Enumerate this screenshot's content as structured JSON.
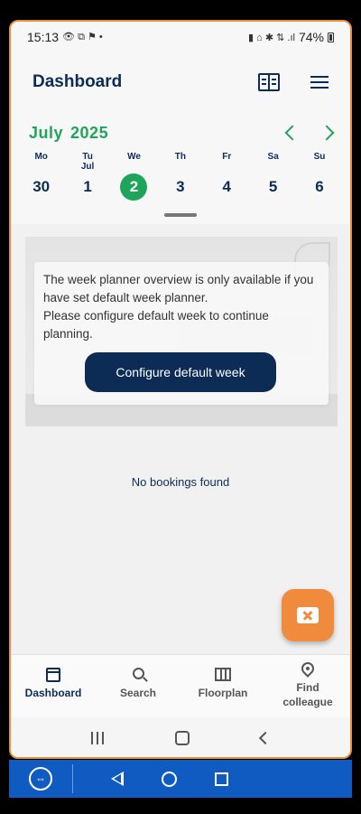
{
  "status_bar": {
    "time": "15:13",
    "indicators": "👁 ⧉ ⚑ •",
    "right_icons": "▮ ⌂ ✱ ⇅ .ıl",
    "battery": "74%"
  },
  "header": {
    "title": "Dashboard",
    "icons": [
      "book-icon",
      "menu-icon"
    ]
  },
  "calendar": {
    "month": "July",
    "year": "2025",
    "days": [
      {
        "dow": "Mo",
        "sub": "",
        "num": "30",
        "selected": false
      },
      {
        "dow": "Tu",
        "sub": "Jul",
        "num": "1",
        "selected": false
      },
      {
        "dow": "We",
        "sub": "",
        "num": "2",
        "selected": true
      },
      {
        "dow": "Th",
        "sub": "",
        "num": "3",
        "selected": false
      },
      {
        "dow": "Fr",
        "sub": "",
        "num": "4",
        "selected": false
      },
      {
        "dow": "Sa",
        "sub": "",
        "num": "5",
        "selected": false
      },
      {
        "dow": "Su",
        "sub": "",
        "num": "6",
        "selected": false
      }
    ]
  },
  "notice": {
    "line1": "The week planner overview is only available if you have set default week planner.",
    "line2": "Please configure default week to continue planning.",
    "button": "Configure default week"
  },
  "empty_state": "No bookings found",
  "bottom_nav": [
    {
      "label": "Dashboard",
      "icon": "calendar-icon",
      "active": true
    },
    {
      "label": "Search",
      "icon": "search-icon",
      "active": false
    },
    {
      "label": "Floorplan",
      "icon": "map-icon",
      "active": false
    },
    {
      "label": "Find colleague",
      "icon": "location-pin-icon",
      "active": false
    }
  ],
  "remote_toolbar": {
    "logo": "⇔"
  },
  "colors": {
    "primary": "#0c2c55",
    "accent_green": "#1fa45c",
    "fab_orange": "#f08a3c",
    "toolbar_blue": "#0f5bc2"
  }
}
